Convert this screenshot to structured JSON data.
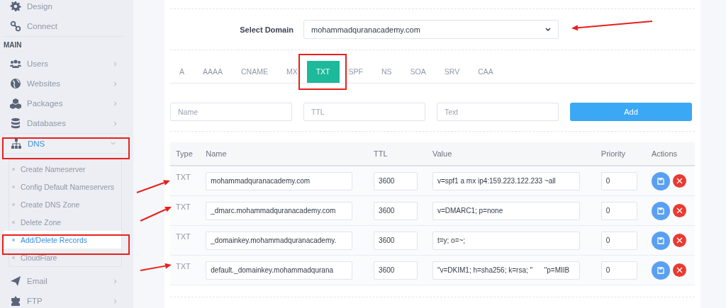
{
  "sidebar": {
    "top_items": [
      {
        "label": "Design"
      },
      {
        "label": "Connect"
      }
    ],
    "section_title": "MAIN",
    "menu": [
      {
        "label": "Users",
        "expanded": false
      },
      {
        "label": "Websites",
        "expanded": false
      },
      {
        "label": "Packages",
        "expanded": false
      },
      {
        "label": "Databases",
        "expanded": false
      },
      {
        "label": "DNS",
        "expanded": true,
        "children": [
          {
            "label": "Create Nameserver",
            "selected": false
          },
          {
            "label": "Config Default Nameservers",
            "selected": false
          },
          {
            "label": "Create DNS Zone",
            "selected": false
          },
          {
            "label": "Delete Zone",
            "selected": false
          },
          {
            "label": "Add/Delete Records",
            "selected": true
          },
          {
            "label": "CloudFlare",
            "selected": false
          }
        ]
      },
      {
        "label": "Email",
        "expanded": false
      },
      {
        "label": "FTP",
        "expanded": false
      }
    ]
  },
  "domain": {
    "label": "Select Domain",
    "value": "mohammadquranacademy.com"
  },
  "tabs": [
    {
      "label": "A",
      "selected": false
    },
    {
      "label": "AAAA",
      "selected": false
    },
    {
      "label": "CNAME",
      "selected": false
    },
    {
      "label": "MX",
      "selected": false
    },
    {
      "label": "TXT",
      "selected": true
    },
    {
      "label": "SPF",
      "selected": false
    },
    {
      "label": "NS",
      "selected": false
    },
    {
      "label": "SOA",
      "selected": false
    },
    {
      "label": "SRV",
      "selected": false
    },
    {
      "label": "CAA",
      "selected": false
    }
  ],
  "new_record": {
    "fields": [
      {
        "placeholder": "Name"
      },
      {
        "placeholder": "TTL"
      },
      {
        "placeholder": "Text"
      }
    ],
    "button": "Add"
  },
  "table": {
    "columns": [
      "Type",
      "Name",
      "TTL",
      "Value",
      "Priority",
      "Actions"
    ],
    "rows": [
      {
        "type": "TXT",
        "name": "mohammadquranacademy.com",
        "ttl": "3600",
        "value": "v=spf1 a mx ip4:159.223.122.233 ~all",
        "priority": "0"
      },
      {
        "type": "TXT",
        "name": "_dmarc.mohammadquranacademy.com",
        "ttl": "3600",
        "value": "v=DMARC1; p=none",
        "priority": "0"
      },
      {
        "type": "TXT",
        "name": "_domainkey.mohammadquranacademy.",
        "ttl": "3600",
        "value": "t=y; o=~;",
        "priority": "0"
      },
      {
        "type": "TXT",
        "name": "default._domainkey.mohammadqurana",
        "ttl": "3600",
        "value": "\"v=DKIM1; h=sha256; k=rsa; \"      \"p=MIIB",
        "priority": "0"
      }
    ]
  }
}
